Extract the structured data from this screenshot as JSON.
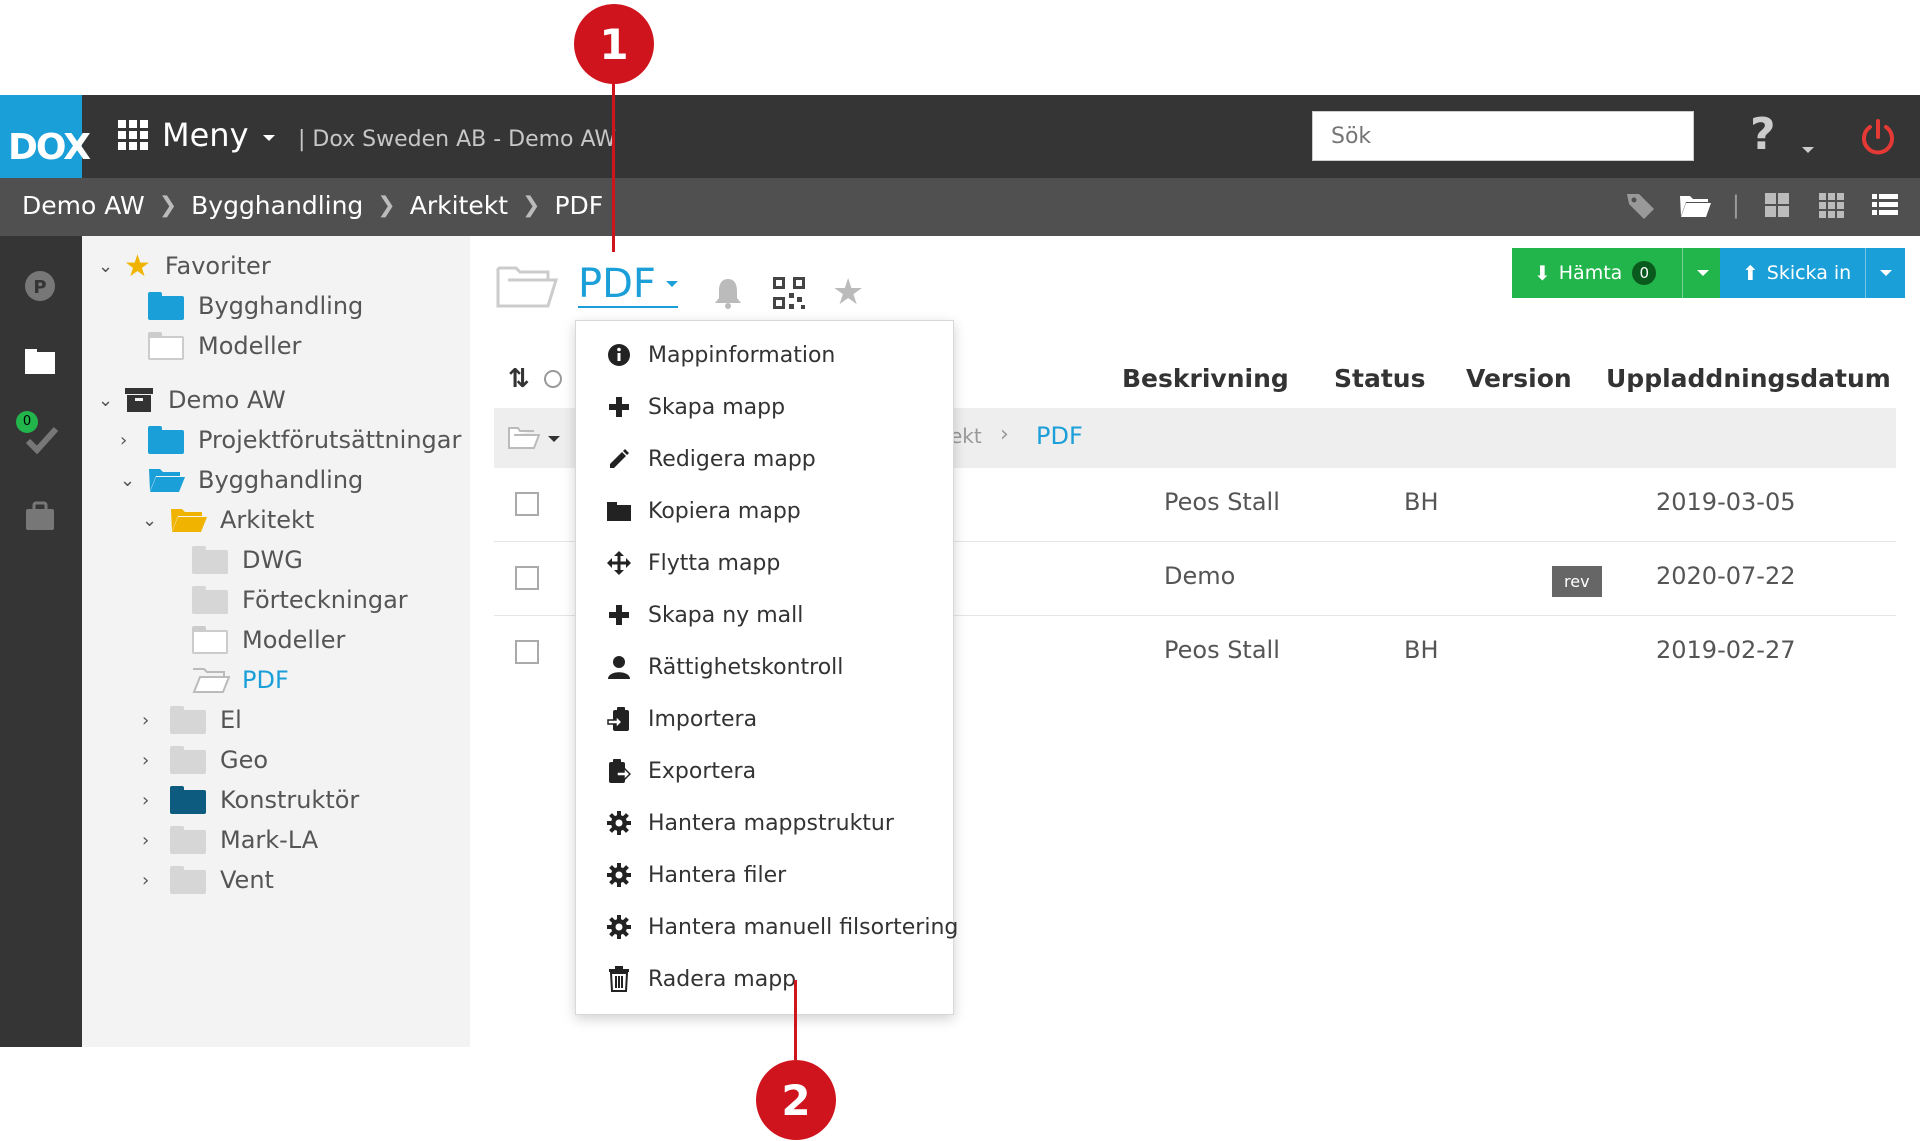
{
  "logo": {
    "text": "DOX"
  },
  "topbar": {
    "menu_label": "Meny",
    "company": "| Dox Sweden AB - Demo AW",
    "search_placeholder": "Sök",
    "help_symbol": "?"
  },
  "breadcrumb": [
    "Demo AW",
    "Bygghandling",
    "Arkitekt",
    "PDF"
  ],
  "rail": {
    "todo_count": "0"
  },
  "tree": {
    "favorites": {
      "label": "Favoriter",
      "items": [
        "Bygghandling",
        "Modeller"
      ]
    },
    "root": {
      "label": "Demo AW",
      "nodes": [
        "Projektförutsättningar",
        "Bygghandling",
        "Arkitekt",
        "DWG",
        "Förteckningar",
        "Modeller",
        "PDF",
        "El",
        "Geo",
        "Konstruktör",
        "Mark-LA",
        "Vent"
      ]
    }
  },
  "main": {
    "folder_title": "PDF",
    "hamta_label": "Hämta",
    "hamta_count": "0",
    "skicka_label": "Skicka in",
    "columns": {
      "beskrivning": "Beskrivning",
      "status": "Status",
      "version": "Version",
      "datum": "Uppladdningsdatum"
    },
    "path_row": {
      "prefix": "ekt",
      "current": "PDF"
    },
    "rows": [
      {
        "beskrivning": "Peos Stall",
        "status": "BH",
        "version": "",
        "datum": "2019-03-05"
      },
      {
        "beskrivning": "Demo",
        "status": "",
        "version": "rev",
        "datum": "2020-07-22"
      },
      {
        "beskrivning": "Peos Stall",
        "status": "BH",
        "version": "",
        "datum": "2019-02-27"
      }
    ]
  },
  "dropdown": {
    "items": [
      {
        "label": "Mappinformation",
        "icon": "info-icon"
      },
      {
        "label": "Skapa mapp",
        "icon": "plus-icon"
      },
      {
        "label": "Redigera mapp",
        "icon": "pencil-icon"
      },
      {
        "label": "Kopiera mapp",
        "icon": "folder-icon"
      },
      {
        "label": "Flytta mapp",
        "icon": "move-icon"
      },
      {
        "label": "Skapa ny mall",
        "icon": "plus-icon"
      },
      {
        "label": "Rättighetskontroll",
        "icon": "user-icon"
      },
      {
        "label": "Importera",
        "icon": "import-icon"
      },
      {
        "label": "Exportera",
        "icon": "export-icon"
      },
      {
        "label": "Hantera mappstruktur",
        "icon": "gear-icon"
      },
      {
        "label": "Hantera filer",
        "icon": "gear-icon"
      },
      {
        "label": "Hantera manuell filsortering",
        "icon": "gear-icon"
      },
      {
        "label": "Radera mapp",
        "icon": "trash-icon"
      }
    ]
  },
  "callouts": [
    "1",
    "2"
  ],
  "colors": {
    "accent": "#1a9fd8",
    "topbar": "#353535",
    "green": "#21b54b",
    "callout": "#d0141e"
  }
}
